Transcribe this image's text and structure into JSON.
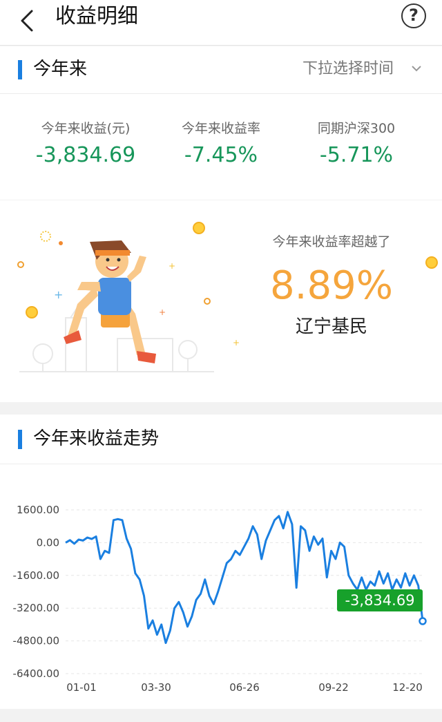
{
  "header": {
    "title": "收益明细",
    "back_icon": "chevron-left-icon",
    "help_icon": "question-circle-icon"
  },
  "summary": {
    "section_title": "今年来",
    "dropdown_label": "下拉选择时间",
    "stats": [
      {
        "label": "今年来收益(元)",
        "value": "-3,834.69"
      },
      {
        "label": "今年来收益率",
        "value": "-7.45%"
      },
      {
        "label": "同期沪深300",
        "value": "-5.71%"
      }
    ],
    "value_color": "#17965a"
  },
  "beat": {
    "label": "今年来收益率超越了",
    "value": "8.89%",
    "who": "辽宁基民",
    "value_color": "#f5a53c"
  },
  "trend": {
    "section_title": "今年来收益走势",
    "accent_color": "#1a7fe0",
    "tag_color": "#17a12b"
  },
  "chart_data": {
    "type": "line",
    "yticks": [
      "1600.00",
      "0.00",
      "-1600.00",
      "-3200.00",
      "-4800.00",
      "-6400.00"
    ],
    "xticks": [
      "01-01",
      "03-30",
      "06-26",
      "09-22",
      "12-20"
    ],
    "ylim": [
      -6400,
      1600
    ],
    "grid": true,
    "end_label": "-3,834.69",
    "series": [
      {
        "values": [
          0,
          120,
          -50,
          150,
          100,
          250,
          180,
          300,
          -800,
          -400,
          -500,
          1100,
          1150,
          1100,
          200,
          -300,
          -1500,
          -1800,
          -2600,
          -4200,
          -3800,
          -4500,
          -4000,
          -4900,
          -4300,
          -3200,
          -2900,
          -3400,
          -4100,
          -3600,
          -2800,
          -2500,
          -1800,
          -2600,
          -3000,
          -2400,
          -1700,
          -1000,
          -800,
          -400,
          -600,
          -200,
          200,
          800,
          400,
          -800,
          100,
          600,
          1100,
          1300,
          700,
          1500,
          900,
          -2200,
          800,
          600,
          -400,
          300,
          -100,
          200,
          -1700,
          -400,
          -800,
          0,
          -200,
          -1600,
          -2000,
          -2300,
          -1700,
          -2300,
          -1900,
          -2100,
          -1400,
          -2000,
          -1500,
          -2300,
          -1800,
          -2200,
          -1500,
          -2100,
          -1600,
          -2100,
          -3834.69
        ]
      }
    ]
  }
}
